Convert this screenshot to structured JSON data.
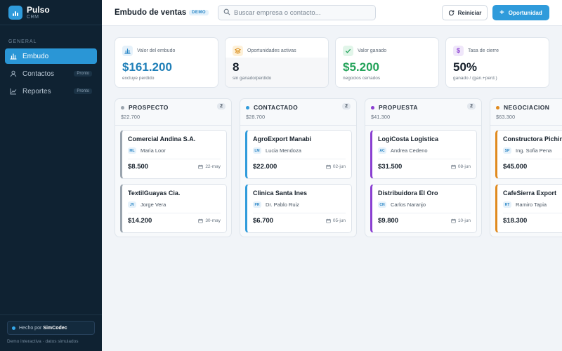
{
  "brand": {
    "name": "Pulso",
    "sub": "CRM"
  },
  "sidebar": {
    "section": "GENERAL",
    "items": [
      {
        "label": "Embudo",
        "badge": "",
        "active": true
      },
      {
        "label": "Contactos",
        "badge": "Pronto",
        "active": false
      },
      {
        "label": "Reportes",
        "badge": "Pronto",
        "active": false
      }
    ],
    "made_by_prefix": "Hecho por",
    "made_by_name": "SimCodec",
    "demo_note": "Demo interactiva · datos simulados"
  },
  "header": {
    "title": "Embudo de ventas",
    "demo_chip": "DEMO",
    "search_placeholder": "Buscar empresa o contacto...",
    "reset_label": "Reiniciar",
    "new_label": "Oportunidad"
  },
  "kpis": [
    {
      "label": "Valor del embudo",
      "value": "$161.200",
      "sub": "excluye perdido",
      "icon": "bar-chart-icon",
      "color": "#1f7fb8",
      "icon_bg": "#e5f1fa"
    },
    {
      "label": "Oportunidades activas",
      "value": "8",
      "sub": "sin ganado/perdido",
      "icon": "layers-icon",
      "color": "#16202b",
      "icon_bg": "#fdf0d8"
    },
    {
      "label": "Valor ganado",
      "value": "$5.200",
      "sub": "negocios cerrados",
      "icon": "check-icon",
      "color": "#24a35a",
      "icon_bg": "#e1f5e9"
    },
    {
      "label": "Tasa de cierre",
      "value": "50%",
      "sub": "ganado / (gan.+perd.)",
      "icon": "dollar-icon",
      "color": "#16202b",
      "icon_bg": "#efe6fa"
    }
  ],
  "columns": [
    {
      "title": "PROSPECTO",
      "count": "2",
      "total": "$22.700",
      "color": "#9aa4ae",
      "cards": [
        {
          "company": "Comercial Andina S.A.",
          "initials": "ML",
          "contact": "Maria Loor",
          "amount": "$8.500",
          "date": "22-may"
        },
        {
          "company": "TextilGuayas Cia.",
          "initials": "JV",
          "contact": "Jorge Vera",
          "amount": "$14.200",
          "date": "30-may"
        }
      ]
    },
    {
      "title": "CONTACTADO",
      "count": "2",
      "total": "$28.700",
      "color": "#2f9bdb",
      "cards": [
        {
          "company": "AgroExport Manabi",
          "initials": "LM",
          "contact": "Lucia Mendoza",
          "amount": "$22.000",
          "date": "02-jun"
        },
        {
          "company": "Clinica Santa Ines",
          "initials": "PR",
          "contact": "Dr. Pablo Ruiz",
          "amount": "$6.700",
          "date": "05-jun"
        }
      ]
    },
    {
      "title": "PROPUESTA",
      "count": "2",
      "total": "$41.300",
      "color": "#8a3fd1",
      "cards": [
        {
          "company": "LogiCosta Logistica",
          "initials": "AC",
          "contact": "Andrea Cedeno",
          "amount": "$31.500",
          "date": "08-jun"
        },
        {
          "company": "Distribuidora El Oro",
          "initials": "CN",
          "contact": "Carlos Naranjo",
          "amount": "$9.800",
          "date": "10-jun"
        }
      ]
    },
    {
      "title": "NEGOCIACION",
      "count": "",
      "total": "$63.300",
      "color": "#e08a1e",
      "cards": [
        {
          "company": "Constructora Pichin",
          "initials": "SP",
          "contact": "Ing. Sofia Pena",
          "amount": "$45.000",
          "date": ""
        },
        {
          "company": "CafeSierra Export",
          "initials": "RT",
          "contact": "Ramiro Tapia",
          "amount": "$18.300",
          "date": ""
        }
      ]
    }
  ]
}
